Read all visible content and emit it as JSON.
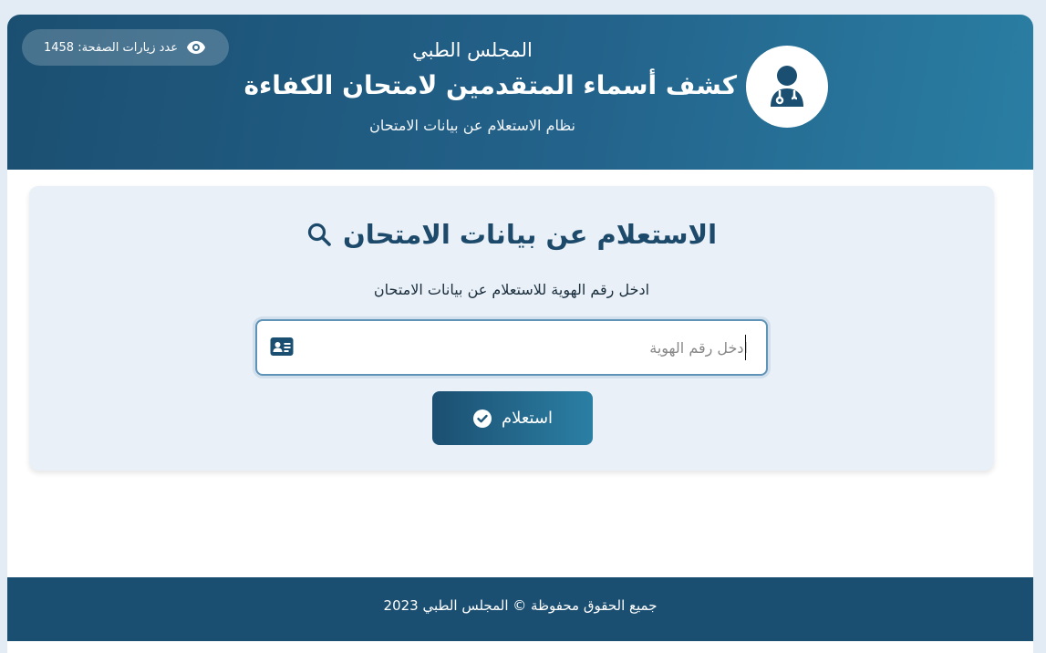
{
  "header": {
    "visits_label": "عدد زيارات الصفحة: 1458",
    "org_name": "المجلس الطبي",
    "title": "كشف أسماء المتقدمين لامتحان الكفاءة",
    "subtitle": "نظام الاستعلام عن بيانات الامتحان",
    "icons": {
      "visits": "eye-icon",
      "logo": "doctor-icon"
    }
  },
  "panel": {
    "title": "الاستعلام عن بيانات الامتحان",
    "instruction": "ادخل رقم الهوية للاستعلام عن بيانات الامتحان",
    "id_input": {
      "placeholder": "ادخل رقم الهوية",
      "value": ""
    },
    "submit_label": "استعلام",
    "icons": {
      "title": "search-icon",
      "id": "id-card-icon",
      "submit": "check-circle-icon"
    }
  },
  "footer": {
    "text": "جميع الحقوق محفوظة © المجلس الطبي 2023"
  },
  "colors": {
    "primary": "#1b4f71",
    "accent": "#2a7ea3",
    "panel_bg": "#e9f0f7",
    "page_bg": "#e3ecf5"
  }
}
